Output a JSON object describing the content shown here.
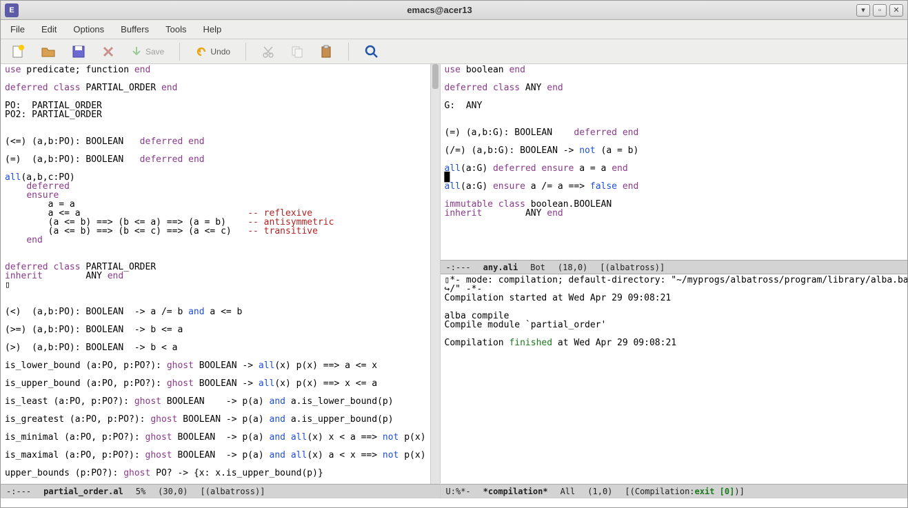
{
  "window": {
    "title": "emacs@acer13"
  },
  "menu": {
    "items": [
      "File",
      "Edit",
      "Options",
      "Buffers",
      "Tools",
      "Help"
    ]
  },
  "toolbar": {
    "save_label": "Save",
    "undo_label": "Undo"
  },
  "left_pane": {
    "lines": [
      [
        {
          "t": "use",
          "c": "kw-purple"
        },
        {
          "t": " predicate; function ",
          "c": ""
        },
        {
          "t": "end",
          "c": "kw-purple"
        }
      ],
      [],
      [
        {
          "t": "deferred class",
          "c": "kw-purple"
        },
        {
          "t": " PARTIAL_ORDER ",
          "c": ""
        },
        {
          "t": "end",
          "c": "kw-purple"
        }
      ],
      [],
      [
        {
          "t": "PO:  PARTIAL_ORDER",
          "c": ""
        }
      ],
      [
        {
          "t": "PO2: PARTIAL_ORDER",
          "c": ""
        }
      ],
      [],
      [],
      [
        {
          "t": "(<=) (a,b:PO): BOOLEAN   ",
          "c": ""
        },
        {
          "t": "deferred end",
          "c": "kw-purple"
        }
      ],
      [],
      [
        {
          "t": "(=)  (a,b:PO): BOOLEAN   ",
          "c": ""
        },
        {
          "t": "deferred end",
          "c": "kw-purple"
        }
      ],
      [],
      [
        {
          "t": "all",
          "c": "kw-blue"
        },
        {
          "t": "(a,b,c:PO)",
          "c": ""
        }
      ],
      [
        {
          "t": "    ",
          "c": ""
        },
        {
          "t": "deferred",
          "c": "kw-purple"
        }
      ],
      [
        {
          "t": "    ",
          "c": ""
        },
        {
          "t": "ensure",
          "c": "kw-purple"
        }
      ],
      [
        {
          "t": "        a = a",
          "c": ""
        }
      ],
      [
        {
          "t": "        a <= a                               ",
          "c": ""
        },
        {
          "t": "-- reflexive",
          "c": "comment"
        }
      ],
      [
        {
          "t": "        (a <= b) ==> (b <= a) ==> (a = b)    ",
          "c": ""
        },
        {
          "t": "-- antisymmetric",
          "c": "comment"
        }
      ],
      [
        {
          "t": "        (a <= b) ==> (b <= c) ==> (a <= c)   ",
          "c": ""
        },
        {
          "t": "-- transitive",
          "c": "comment"
        }
      ],
      [
        {
          "t": "    ",
          "c": ""
        },
        {
          "t": "end",
          "c": "kw-purple"
        }
      ],
      [],
      [],
      [
        {
          "t": "deferred class",
          "c": "kw-purple"
        },
        {
          "t": " PARTIAL_ORDER",
          "c": ""
        }
      ],
      [
        {
          "t": "inherit",
          "c": "kw-purple"
        },
        {
          "t": "        ANY ",
          "c": ""
        },
        {
          "t": "end",
          "c": "kw-purple"
        }
      ],
      [
        {
          "t": "▯",
          "c": ""
        }
      ],
      [],
      [],
      [
        {
          "t": "(<)  (a,b:PO): BOOLEAN  -> a /= b ",
          "c": ""
        },
        {
          "t": "and",
          "c": "kw-blue"
        },
        {
          "t": " a <= b",
          "c": ""
        }
      ],
      [],
      [
        {
          "t": "(>=) (a,b:PO): BOOLEAN  -> b <= a",
          "c": ""
        }
      ],
      [],
      [
        {
          "t": "(>)  (a,b:PO): BOOLEAN  -> b < a",
          "c": ""
        }
      ],
      [],
      [
        {
          "t": "is_lower_bound (a:PO, p:PO?): ",
          "c": ""
        },
        {
          "t": "ghost",
          "c": "kw-purple"
        },
        {
          "t": " BOOLEAN -> ",
          "c": ""
        },
        {
          "t": "all",
          "c": "kw-blue"
        },
        {
          "t": "(x) p(x) ==> a <= x",
          "c": ""
        }
      ],
      [],
      [
        {
          "t": "is_upper_bound (a:PO, p:PO?): ",
          "c": ""
        },
        {
          "t": "ghost",
          "c": "kw-purple"
        },
        {
          "t": " BOOLEAN -> ",
          "c": ""
        },
        {
          "t": "all",
          "c": "kw-blue"
        },
        {
          "t": "(x) p(x) ==> x <= a",
          "c": ""
        }
      ],
      [],
      [
        {
          "t": "is_least (a:PO, p:PO?): ",
          "c": ""
        },
        {
          "t": "ghost",
          "c": "kw-purple"
        },
        {
          "t": " BOOLEAN    -> p(a) ",
          "c": ""
        },
        {
          "t": "and",
          "c": "kw-blue"
        },
        {
          "t": " a.is_lower_bound(p)",
          "c": ""
        }
      ],
      [],
      [
        {
          "t": "is_greatest (a:PO, p:PO?): ",
          "c": ""
        },
        {
          "t": "ghost",
          "c": "kw-purple"
        },
        {
          "t": " BOOLEAN -> p(a) ",
          "c": ""
        },
        {
          "t": "and",
          "c": "kw-blue"
        },
        {
          "t": " a.is_upper_bound(p)",
          "c": ""
        }
      ],
      [],
      [
        {
          "t": "is_minimal (a:PO, p:PO?): ",
          "c": ""
        },
        {
          "t": "ghost",
          "c": "kw-purple"
        },
        {
          "t": " BOOLEAN  -> p(a) ",
          "c": ""
        },
        {
          "t": "and",
          "c": "kw-blue"
        },
        {
          "t": " ",
          "c": ""
        },
        {
          "t": "all",
          "c": "kw-blue"
        },
        {
          "t": "(x) x < a ==> ",
          "c": ""
        },
        {
          "t": "not",
          "c": "kw-blue"
        },
        {
          "t": " p(x)",
          "c": ""
        }
      ],
      [],
      [
        {
          "t": "is_maximal (a:PO, p:PO?): ",
          "c": ""
        },
        {
          "t": "ghost",
          "c": "kw-purple"
        },
        {
          "t": " BOOLEAN  -> p(a) ",
          "c": ""
        },
        {
          "t": "and",
          "c": "kw-blue"
        },
        {
          "t": " ",
          "c": ""
        },
        {
          "t": "all",
          "c": "kw-blue"
        },
        {
          "t": "(x) a < x ==> ",
          "c": ""
        },
        {
          "t": "not",
          "c": "kw-blue"
        },
        {
          "t": " p(x)",
          "c": ""
        }
      ],
      [],
      [
        {
          "t": "upper_bounds (p:PO?): ",
          "c": ""
        },
        {
          "t": "ghost",
          "c": "kw-purple"
        },
        {
          "t": " PO? -> {x: x.is_upper_bound(p)}",
          "c": ""
        }
      ]
    ],
    "modeline": {
      "status": "-:---",
      "filename": "partial_order.al",
      "percent": "5%",
      "pos": "(30,0)",
      "mode": "[(albatross)]"
    }
  },
  "right_top": {
    "lines": [
      [
        {
          "t": "use",
          "c": "kw-purple"
        },
        {
          "t": " boolean ",
          "c": ""
        },
        {
          "t": "end",
          "c": "kw-purple"
        }
      ],
      [],
      [
        {
          "t": "deferred class",
          "c": "kw-purple"
        },
        {
          "t": " ANY ",
          "c": ""
        },
        {
          "t": "end",
          "c": "kw-purple"
        }
      ],
      [],
      [
        {
          "t": "G:  ANY",
          "c": ""
        }
      ],
      [],
      [],
      [
        {
          "t": "(=) (a,b:G): BOOLEAN    ",
          "c": ""
        },
        {
          "t": "deferred end",
          "c": "kw-purple"
        }
      ],
      [],
      [
        {
          "t": "(/=) (a,b:G): BOOLEAN -> ",
          "c": ""
        },
        {
          "t": "not",
          "c": "kw-blue"
        },
        {
          "t": " (a = b)",
          "c": ""
        }
      ],
      [],
      [
        {
          "t": "all",
          "c": "kw-blue"
        },
        {
          "t": "(a:G) ",
          "c": ""
        },
        {
          "t": "deferred ensure",
          "c": "kw-purple"
        },
        {
          "t": " a = a ",
          "c": ""
        },
        {
          "t": "end",
          "c": "kw-purple"
        }
      ],
      [
        {
          "t": "█",
          "c": ""
        }
      ],
      [
        {
          "t": "all",
          "c": "kw-blue"
        },
        {
          "t": "(a:G) ",
          "c": ""
        },
        {
          "t": "ensure",
          "c": "kw-purple"
        },
        {
          "t": " a /= a ==> ",
          "c": ""
        },
        {
          "t": "false",
          "c": "kw-blue"
        },
        {
          "t": " ",
          "c": ""
        },
        {
          "t": "end",
          "c": "kw-purple"
        }
      ],
      [],
      [
        {
          "t": "immutable class",
          "c": "kw-purple"
        },
        {
          "t": " boolean.BOOLEAN",
          "c": ""
        }
      ],
      [
        {
          "t": "inherit",
          "c": "kw-purple"
        },
        {
          "t": "        ANY ",
          "c": ""
        },
        {
          "t": "end",
          "c": "kw-purple"
        }
      ]
    ],
    "modeline": {
      "status": "-:---",
      "filename": "any.ali",
      "percent": "Bot",
      "pos": "(18,0)",
      "mode": "[(albatross)]"
    }
  },
  "right_bottom": {
    "lines": [
      [
        {
          "t": "▯*- mode: compilation; default-directory: \"~/myprogs/albatross/program/library/alba.base⤶",
          "c": ""
        }
      ],
      [
        {
          "t": "↪/\" -*-",
          "c": ""
        }
      ],
      [
        {
          "t": "Compilation started at Wed Apr 29 09:08:21",
          "c": ""
        }
      ],
      [],
      [
        {
          "t": "alba compile",
          "c": ""
        }
      ],
      [
        {
          "t": "Compile module `partial_order'",
          "c": ""
        }
      ],
      [],
      [
        {
          "t": "Compilation ",
          "c": ""
        },
        {
          "t": "finished",
          "c": "kw-green"
        },
        {
          "t": " at Wed Apr 29 09:08:21",
          "c": ""
        }
      ]
    ],
    "modeline": {
      "status": "U:%*-",
      "filename": "*compilation*",
      "percent": "All",
      "pos": "(1,0)",
      "mode_prefix": "[(Compilation:",
      "mode_exit": "exit [0]",
      "mode_suffix": ")]"
    }
  }
}
